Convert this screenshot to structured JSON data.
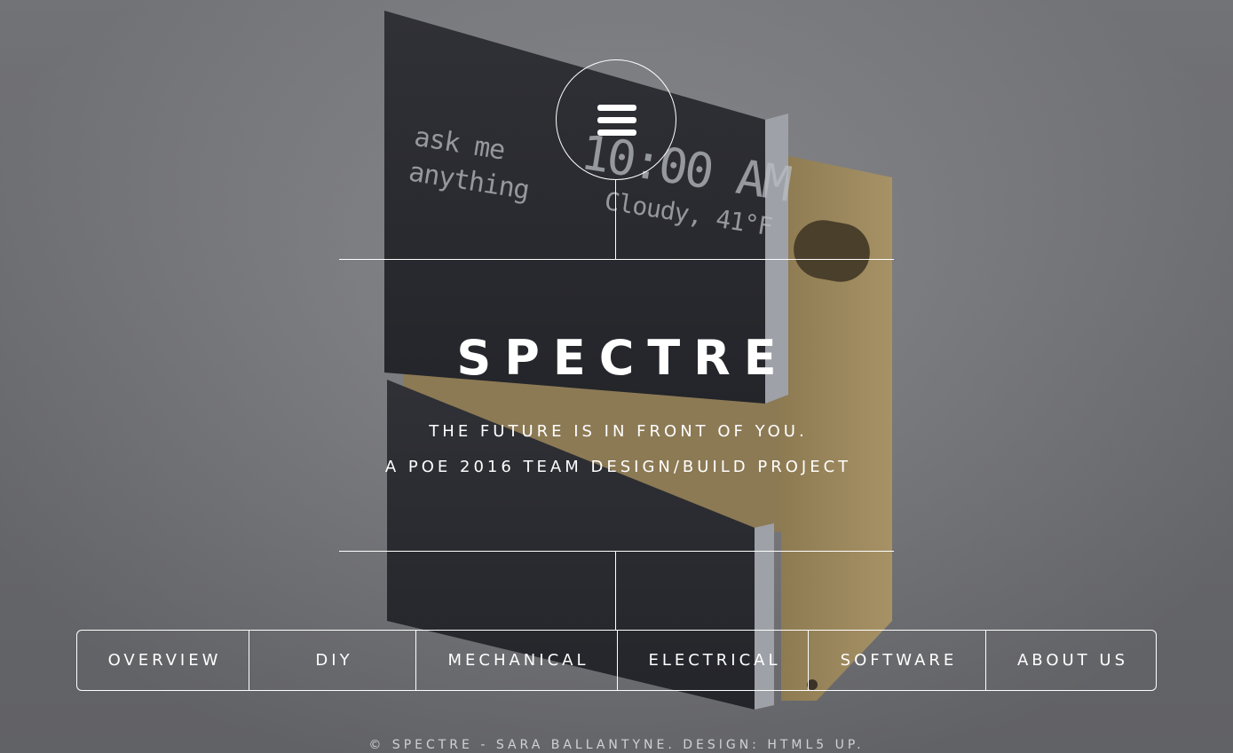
{
  "header": {
    "menu_icon": "hamburger-menu-icon"
  },
  "device_screen": {
    "left_text_line1": "ask me",
    "left_text_line2": "anything",
    "time": "10:00 AM",
    "weather": "Cloudy, 41°F"
  },
  "banner": {
    "title": "SPECTRE",
    "tagline_1": "THE FUTURE IS IN FRONT OF YOU.",
    "tagline_2": "A POE 2016 TEAM DESIGN/BUILD PROJECT"
  },
  "nav": {
    "items": [
      {
        "label": "OVERVIEW"
      },
      {
        "label": "DIY"
      },
      {
        "label": "MECHANICAL"
      },
      {
        "label": "ELECTRICAL"
      },
      {
        "label": "SOFTWARE"
      },
      {
        "label": "ABOUT US"
      }
    ]
  },
  "footer": {
    "text": "© SPECTRE - SARA BALLANTYNE. DESIGN: HTML5 UP."
  },
  "colors": {
    "background": "#7b7c80",
    "foreground": "#ffffff",
    "panel_dark": "#2a2b2f",
    "wood": "#a08a5e"
  }
}
